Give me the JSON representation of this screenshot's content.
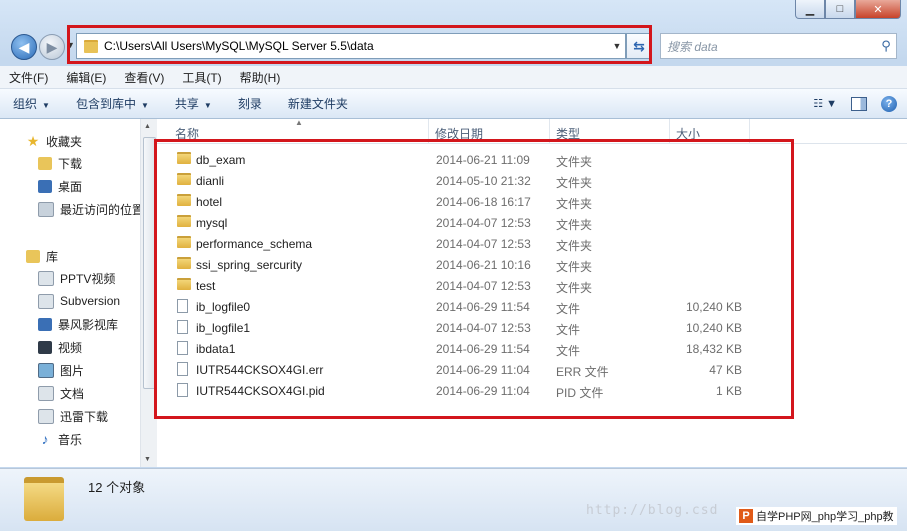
{
  "address": {
    "path": "C:\\Users\\All Users\\MySQL\\MySQL Server 5.5\\data"
  },
  "search": {
    "placeholder": "搜索 data"
  },
  "menu": [
    "文件(F)",
    "编辑(E)",
    "查看(V)",
    "工具(T)",
    "帮助(H)"
  ],
  "toolbar": {
    "organize": "组织",
    "include": "包含到库中",
    "share": "共享",
    "burn": "刻录",
    "new_folder": "新建文件夹"
  },
  "nav": {
    "favorites": "收藏夹",
    "fav_items": [
      "下载",
      "桌面",
      "最近访问的位置"
    ],
    "libraries": "库",
    "lib_items": [
      "PPTV视频",
      "Subversion",
      "暴风影视库",
      "视频",
      "图片",
      "文档",
      "迅雷下载",
      "音乐"
    ]
  },
  "columns": {
    "name": "名称",
    "date": "修改日期",
    "type": "类型",
    "size": "大小"
  },
  "files": [
    {
      "name": "db_exam",
      "date": "2014-06-21 11:09",
      "type": "文件夹",
      "size": "",
      "kind": "folder"
    },
    {
      "name": "dianli",
      "date": "2014-05-10 21:32",
      "type": "文件夹",
      "size": "",
      "kind": "folder"
    },
    {
      "name": "hotel",
      "date": "2014-06-18 16:17",
      "type": "文件夹",
      "size": "",
      "kind": "folder"
    },
    {
      "name": "mysql",
      "date": "2014-04-07 12:53",
      "type": "文件夹",
      "size": "",
      "kind": "folder"
    },
    {
      "name": "performance_schema",
      "date": "2014-04-07 12:53",
      "type": "文件夹",
      "size": "",
      "kind": "folder"
    },
    {
      "name": "ssi_spring_sercurity",
      "date": "2014-06-21 10:16",
      "type": "文件夹",
      "size": "",
      "kind": "folder"
    },
    {
      "name": "test",
      "date": "2014-04-07 12:53",
      "type": "文件夹",
      "size": "",
      "kind": "folder"
    },
    {
      "name": "ib_logfile0",
      "date": "2014-06-29 11:54",
      "type": "文件",
      "size": "10,240 KB",
      "kind": "file"
    },
    {
      "name": "ib_logfile1",
      "date": "2014-04-07 12:53",
      "type": "文件",
      "size": "10,240 KB",
      "kind": "file"
    },
    {
      "name": "ibdata1",
      "date": "2014-06-29 11:54",
      "type": "文件",
      "size": "18,432 KB",
      "kind": "file"
    },
    {
      "name": "IUTR544CKSOX4GI.err",
      "date": "2014-06-29 11:04",
      "type": "ERR 文件",
      "size": "47 KB",
      "kind": "file"
    },
    {
      "name": "IUTR544CKSOX4GI.pid",
      "date": "2014-06-29 11:04",
      "type": "PID 文件",
      "size": "1 KB",
      "kind": "file"
    }
  ],
  "status": {
    "count": "12 个对象"
  },
  "watermark": {
    "url": "http://blog.csd",
    "logo_text": "自学PHP网_php学习_php教"
  }
}
